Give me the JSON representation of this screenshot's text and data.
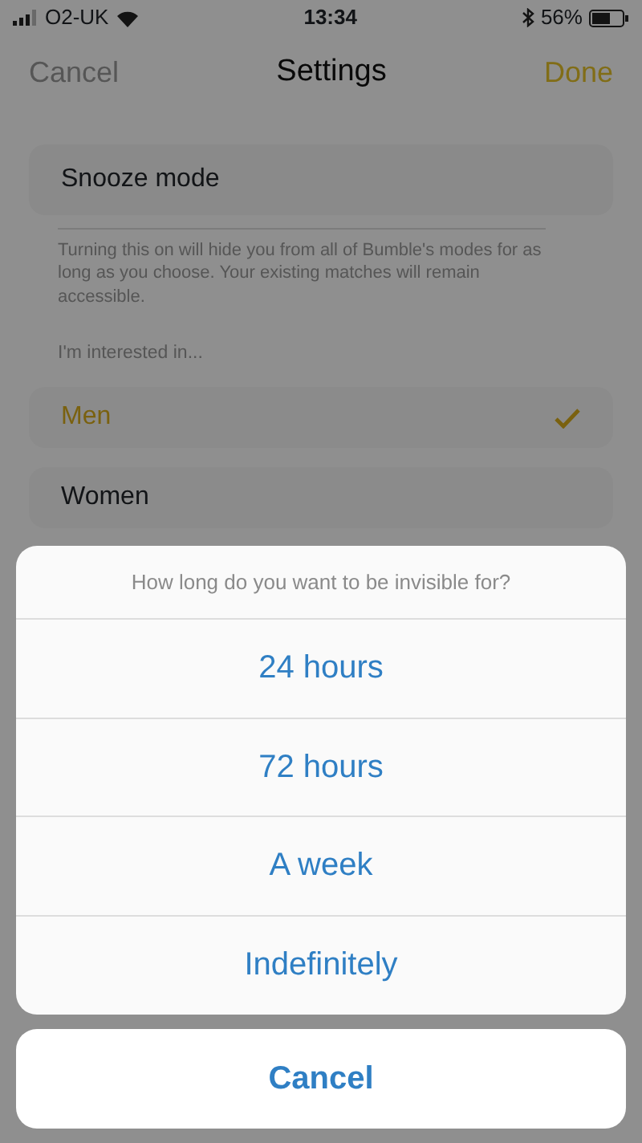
{
  "status_bar": {
    "carrier": "O2-UK",
    "time": "13:34",
    "battery": "56%"
  },
  "nav_bar": {
    "left": "Cancel",
    "title": "Settings",
    "right": "Done"
  },
  "snooze": {
    "label": "Snooze mode",
    "description": "Turning this on will hide you from all of Bumble's modes for as long as you choose. Your existing matches will remain accessible."
  },
  "interest": {
    "heading": "I'm interested in...",
    "options": [
      {
        "label": "Men",
        "selected": true
      },
      {
        "label": "Women",
        "selected": false
      }
    ]
  },
  "action_sheet": {
    "title": "How long do you want to be invisible for?",
    "options": [
      "24 hours",
      "72 hours",
      "A week",
      "Indefinitely"
    ],
    "cancel": "Cancel"
  }
}
